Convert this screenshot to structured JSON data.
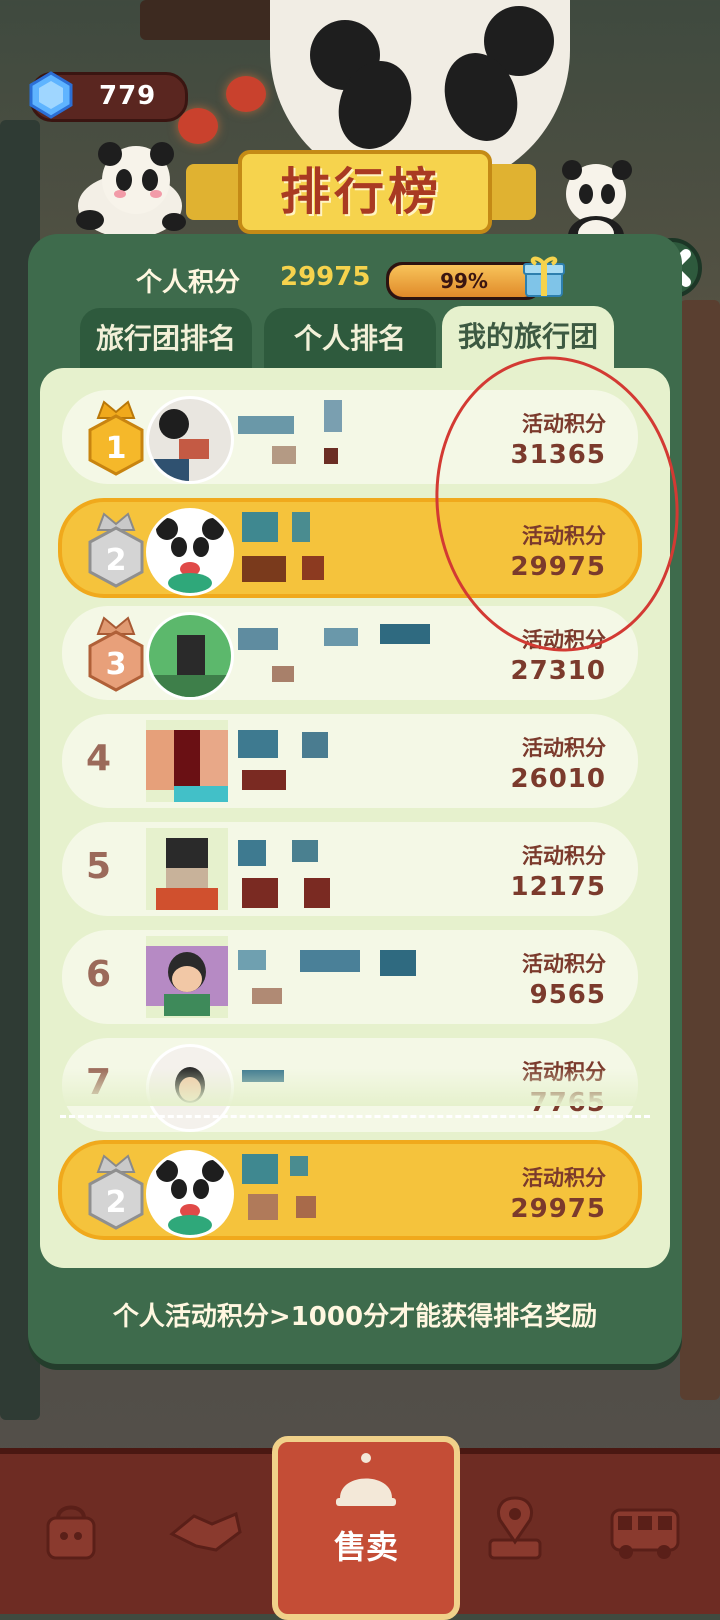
{
  "header": {
    "gem_count": "779",
    "title": "排行榜"
  },
  "panel": {
    "score_label": "个人积分",
    "score_value": "29975",
    "progress_text": "99%",
    "progress_fraction": 0.99,
    "tabs": [
      {
        "label": "旅行团排名",
        "active": false
      },
      {
        "label": "个人排名",
        "active": false
      },
      {
        "label": "我的旅行团",
        "active": true
      }
    ],
    "score_column_label": "活动积分",
    "rows": [
      {
        "rank": "1",
        "score": "31365"
      },
      {
        "rank": "2",
        "score": "29975"
      },
      {
        "rank": "3",
        "score": "27310"
      },
      {
        "rank": "4",
        "score": "26010"
      },
      {
        "rank": "5",
        "score": "12175"
      },
      {
        "rank": "6",
        "score": "9565"
      },
      {
        "rank": "7",
        "score": "7765"
      }
    ],
    "my_row": {
      "rank": "2",
      "score": "29975"
    },
    "footer_note": "个人活动积分>1000分才能获得排名奖励"
  },
  "bottom_nav": {
    "center_label": "售卖"
  },
  "colors": {
    "panel_green": "#3e6b4c",
    "list_bg": "#e6f1cd",
    "highlight_gold": "#f5c33c",
    "score_brown": "#7b3a2c",
    "title_red": "#a93a22"
  }
}
